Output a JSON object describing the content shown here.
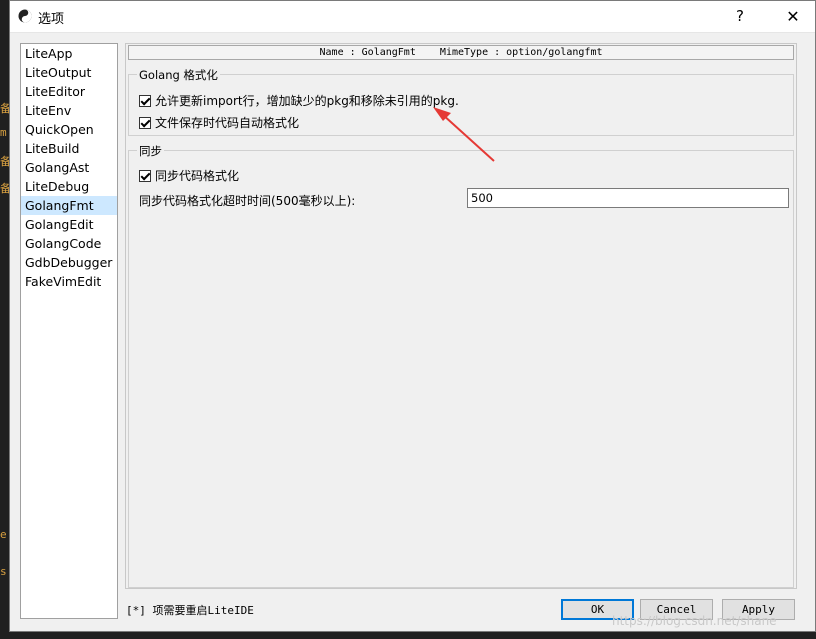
{
  "window": {
    "title": "选项",
    "help_glyph": "?",
    "close_glyph": "✕"
  },
  "background_text": [
    "备",
    "m",
    "备",
    "备",
    "e",
    "s"
  ],
  "sidebar": {
    "items": [
      {
        "label": "LiteApp"
      },
      {
        "label": "LiteOutput"
      },
      {
        "label": "LiteEditor"
      },
      {
        "label": "LiteEnv"
      },
      {
        "label": "QuickOpen"
      },
      {
        "label": "LiteBuild"
      },
      {
        "label": "GolangAst"
      },
      {
        "label": "LiteDebug"
      },
      {
        "label": "GolangFmt",
        "selected": true
      },
      {
        "label": "GolangEdit"
      },
      {
        "label": "GolangCode"
      },
      {
        "label": "GdbDebugger"
      },
      {
        "label": "FakeVimEdit"
      }
    ]
  },
  "info_bar": "Name : GolangFmt    MimeType : option/golangfmt",
  "golang_group": {
    "title": "Golang 格式化",
    "options": [
      {
        "label": "允许更新import行，增加缺少的pkg和移除未引用的pkg.",
        "checked": true
      },
      {
        "label": "文件保存时代码自动格式化",
        "checked": true
      }
    ]
  },
  "sync_group": {
    "title": "同步",
    "sync_option": {
      "label": "同步代码格式化",
      "checked": true
    },
    "timeout_label": "同步代码格式化超时时间(500毫秒以上):",
    "timeout_value": "500"
  },
  "footer": {
    "restart_note": "[*] 项需要重启LiteIDE",
    "ok_label": "OK",
    "cancel_label": "Cancel",
    "apply_label": "Apply"
  },
  "watermark": "https://blog.csdn.net/shane",
  "colors": {
    "annotation_arrow": "#e53935",
    "selection": "#cde8ff",
    "default_button_border": "#0078d7"
  }
}
